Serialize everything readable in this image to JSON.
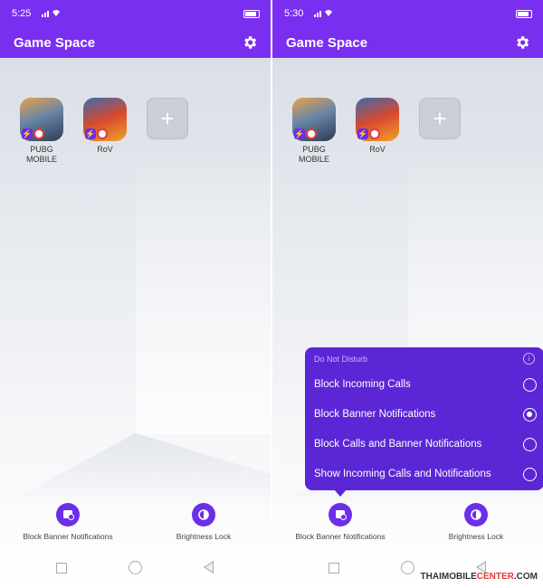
{
  "left_screen": {
    "status_time": "5:25",
    "app_title": "Game Space",
    "apps": [
      {
        "name": "PUBG MOBILE"
      },
      {
        "name": "RoV"
      }
    ],
    "add_symbol": "+",
    "bottom_buttons": [
      {
        "label": "Block Banner Notifications",
        "icon": "block-notification-icon"
      },
      {
        "label": "Brightness Lock",
        "icon": "brightness-icon"
      }
    ]
  },
  "right_screen": {
    "status_time": "5:30",
    "app_title": "Game Space",
    "apps": [
      {
        "name": "PUBG MOBILE"
      },
      {
        "name": "RoV"
      }
    ],
    "add_symbol": "+",
    "bottom_buttons": [
      {
        "label": "Block Banner Notifications",
        "icon": "block-notification-icon"
      },
      {
        "label": "Brightness Lock",
        "icon": "brightness-icon"
      }
    ],
    "dnd_popup": {
      "title": "Do Not Disturb",
      "info_symbol": "i",
      "options": [
        {
          "label": "Block Incoming Calls",
          "selected": false
        },
        {
          "label": "Block Banner Notifications",
          "selected": true
        },
        {
          "label": "Block Calls and Banner Notifications",
          "selected": false
        },
        {
          "label": "Show Incoming Calls and Notifications",
          "selected": false
        }
      ]
    }
  },
  "watermark": {
    "part1": "THAIMOBILE",
    "part2": "CENTER",
    "part3": ".COM"
  },
  "colors": {
    "accent": "#7a2ff0",
    "popup": "#5b26d6"
  }
}
